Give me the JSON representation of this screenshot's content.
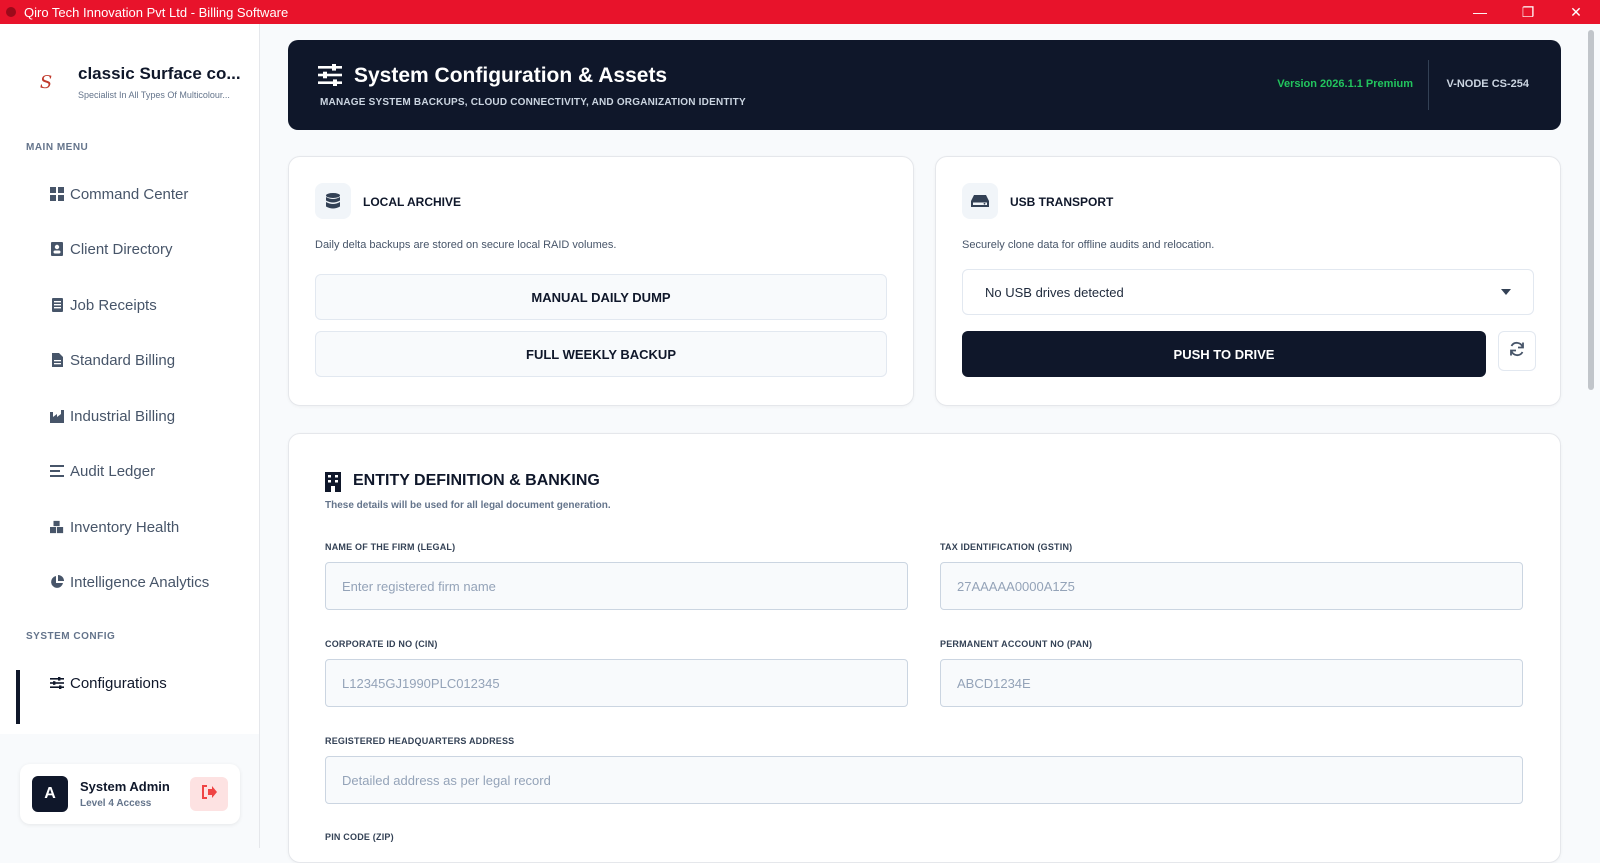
{
  "window": {
    "title": "Qiro Tech Innovation Pvt Ltd - Billing Software",
    "controls": [
      "—",
      "❐",
      "✕"
    ]
  },
  "brand": {
    "name": "classic Surface co...",
    "tagline": "Specialist In All Types Of Multicolour...",
    "logo_letter": "S"
  },
  "sidebar": {
    "main_menu_label": "MAIN MENU",
    "items": [
      {
        "label": "Command Center",
        "icon": "dashboard-icon"
      },
      {
        "label": "Client Directory",
        "icon": "contact-card-icon"
      },
      {
        "label": "Job Receipts",
        "icon": "receipt-icon"
      },
      {
        "label": "Standard Billing",
        "icon": "document-icon"
      },
      {
        "label": "Industrial Billing",
        "icon": "factory-icon"
      },
      {
        "label": "Audit Ledger",
        "icon": "list-icon"
      },
      {
        "label": "Inventory Health",
        "icon": "boxes-icon"
      },
      {
        "label": "Intelligence Analytics",
        "icon": "pie-chart-icon"
      }
    ],
    "system_config_label": "SYSTEM CONFIG",
    "config_item": {
      "label": "Configurations",
      "icon": "sliders-icon"
    }
  },
  "user": {
    "initial": "A",
    "name": "System Admin",
    "role": "Level 4 Access"
  },
  "header": {
    "title": "System Configuration & Assets",
    "subtitle": "MANAGE SYSTEM BACKUPS, CLOUD CONNECTIVITY, AND ORGANIZATION IDENTITY",
    "version": "Version 2026.1.1 Premium",
    "node": "V-NODE CS-254"
  },
  "local_archive": {
    "title": "LOCAL ARCHIVE",
    "description": "Daily delta backups are stored on secure local RAID volumes.",
    "manual_button": "MANUAL DAILY DUMP",
    "weekly_button": "FULL WEEKLY BACKUP"
  },
  "usb_transport": {
    "title": "USB TRANSPORT",
    "description": "Securely clone data for offline audits and relocation.",
    "selected_drive": "No USB drives detected",
    "push_button": "PUSH TO DRIVE"
  },
  "entity": {
    "title": "ENTITY DEFINITION & BANKING",
    "subtitle": "These details will be used for all legal document generation.",
    "fields": {
      "firm_name": {
        "label": "NAME OF THE FIRM (LEGAL)",
        "placeholder": "Enter registered firm name"
      },
      "gstin": {
        "label": "TAX IDENTIFICATION (GSTIN)",
        "placeholder": "27AAAAA0000A1Z5"
      },
      "cin": {
        "label": "CORPORATE ID NO (CIN)",
        "placeholder": "L12345GJ1990PLC012345"
      },
      "pan": {
        "label": "PERMANENT ACCOUNT NO (PAN)",
        "placeholder": "ABCD1234E"
      },
      "address": {
        "label": "REGISTERED HEADQUARTERS ADDRESS",
        "placeholder": "Detailed address as per legal record"
      },
      "pin": {
        "label": "PIN CODE (ZIP)"
      }
    }
  }
}
